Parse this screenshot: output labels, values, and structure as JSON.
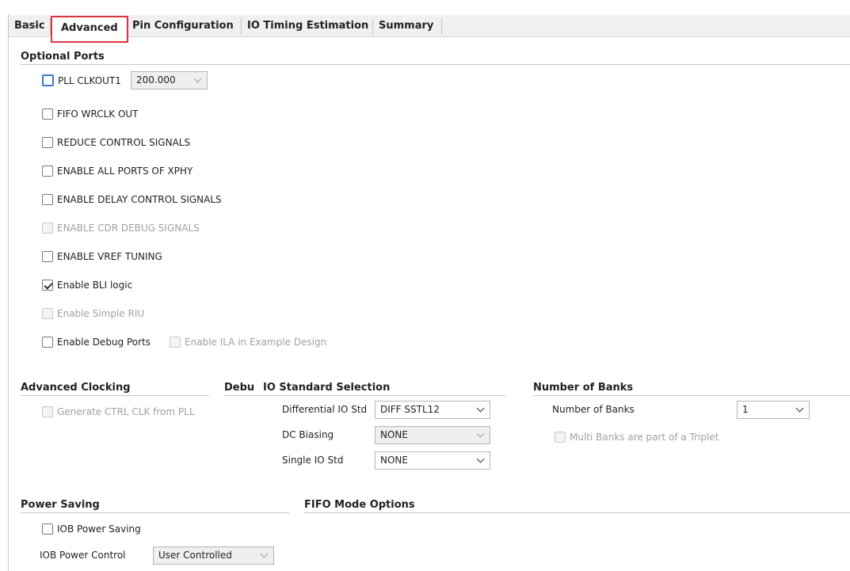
{
  "tabs": [
    {
      "label": "Basic"
    },
    {
      "label": "Advanced"
    },
    {
      "label": "Pin Configuration"
    },
    {
      "label": "IO Timing Estimation"
    },
    {
      "label": "Summary"
    }
  ],
  "optional_ports": {
    "title": "Optional Ports",
    "pll_clkout1": {
      "label": "PLL CLKOUT1",
      "value": "200.000"
    },
    "fifo_wrclk_out": "FIFO WRCLK OUT",
    "reduce_control_signals": "REDUCE CONTROL SIGNALS",
    "enable_all_ports_xphy": "ENABLE ALL PORTS OF XPHY",
    "enable_delay_control": "ENABLE DELAY CONTROL SIGNALS",
    "enable_cdr_debug": "ENABLE CDR DEBUG SIGNALS",
    "enable_vref_tuning": "ENABLE VREF TUNING",
    "enable_bli_logic": "Enable BLI logic",
    "enable_simple_riu": "Enable Simple RIU",
    "enable_debug_ports": "Enable Debug Ports",
    "enable_ila": "Enable ILA in Example Design"
  },
  "advanced_clocking": {
    "title": "Advanced Clocking",
    "generate_ctrl_clk": "Generate CTRL CLK from PLL"
  },
  "debug_title_partial": "Debu",
  "io_standard": {
    "title": "IO Standard Selection",
    "differential_label": "Differential IO Std",
    "differential_value": "DIFF SSTL12",
    "dc_biasing_label": "DC Biasing",
    "dc_biasing_value": "NONE",
    "single_label": "Single IO Std",
    "single_value": "NONE"
  },
  "number_of_banks": {
    "title": "Number of Banks",
    "label": "Number of Banks",
    "value": "1",
    "multi_banks": "Multi Banks are part of a Triplet"
  },
  "power_saving": {
    "title": "Power Saving",
    "iob_power_saving": "IOB Power Saving",
    "iob_power_control_label": "IOB Power Control",
    "iob_power_control_value": "User Controlled"
  },
  "fifo_mode": {
    "title": "FIFO Mode Options"
  }
}
